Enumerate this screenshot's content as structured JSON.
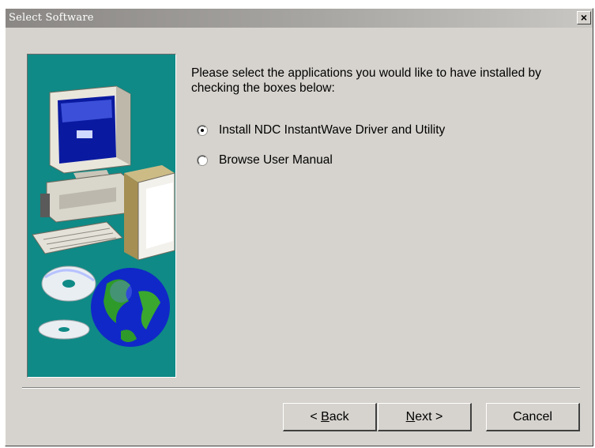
{
  "window": {
    "title": "Select Software"
  },
  "title_bar": {
    "close_label": "×"
  },
  "content": {
    "prompt": "Please select the applications you would like to have installed by checking the boxes below:",
    "options": [
      {
        "label": "Install NDC InstantWave Driver and Utility",
        "selected": true
      },
      {
        "label": "Browse User Manual",
        "selected": false
      }
    ]
  },
  "side_image": {
    "icons": [
      "computer-icon",
      "software-box-icon",
      "cd-disc-icon",
      "globe-icon"
    ],
    "background_color": "#0f8a86"
  },
  "buttons": {
    "back": {
      "mnemonic": "B",
      "rest": "ack",
      "prefix": "< "
    },
    "next": {
      "mnemonic": "N",
      "rest": "ext >"
    },
    "cancel": "Cancel"
  }
}
